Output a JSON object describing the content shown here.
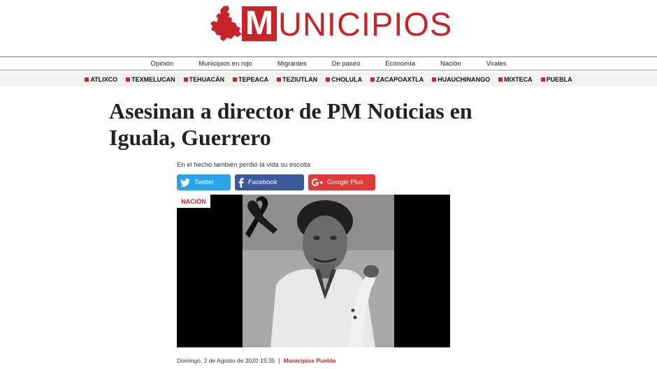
{
  "logo": {
    "letter": "M",
    "rest": "UNICIPIOS"
  },
  "nav": [
    "Opinión",
    "Municipios en rojo",
    "Migrantes",
    "De paseo",
    "Economía",
    "Nación",
    "Virales"
  ],
  "municipalities": [
    "ATLIXCO",
    "TEXMELUCAN",
    "TEHUACÁN",
    "TEPEACA",
    "TEZIUTLAN",
    "CHOLULA",
    "ZACAPOAXTLA",
    "HUAUCHINANGO",
    "MIXTECA",
    "PUEBLA"
  ],
  "article": {
    "title": "Asesinan a director de PM Noticias en Iguala, Guerrero",
    "subtitle": "En el hecho también perdió la vida su escolta",
    "category": "NACIÓN",
    "date": "Domingo, 2 de Agosto de 2020 15:35",
    "separator": "|",
    "author": "Municipios Puebla"
  },
  "share": {
    "twitter": "Twitter",
    "facebook": "Facebook",
    "google": "Google Plus"
  },
  "colors": {
    "brand": "#c8242b",
    "twitter": "#2aa3e8",
    "facebook": "#3b5998",
    "google": "#db3a36"
  },
  "icons": [
    "puebla-map-icon",
    "twitter-icon",
    "facebook-icon",
    "google-plus-icon",
    "mourning-ribbon-icon"
  ]
}
